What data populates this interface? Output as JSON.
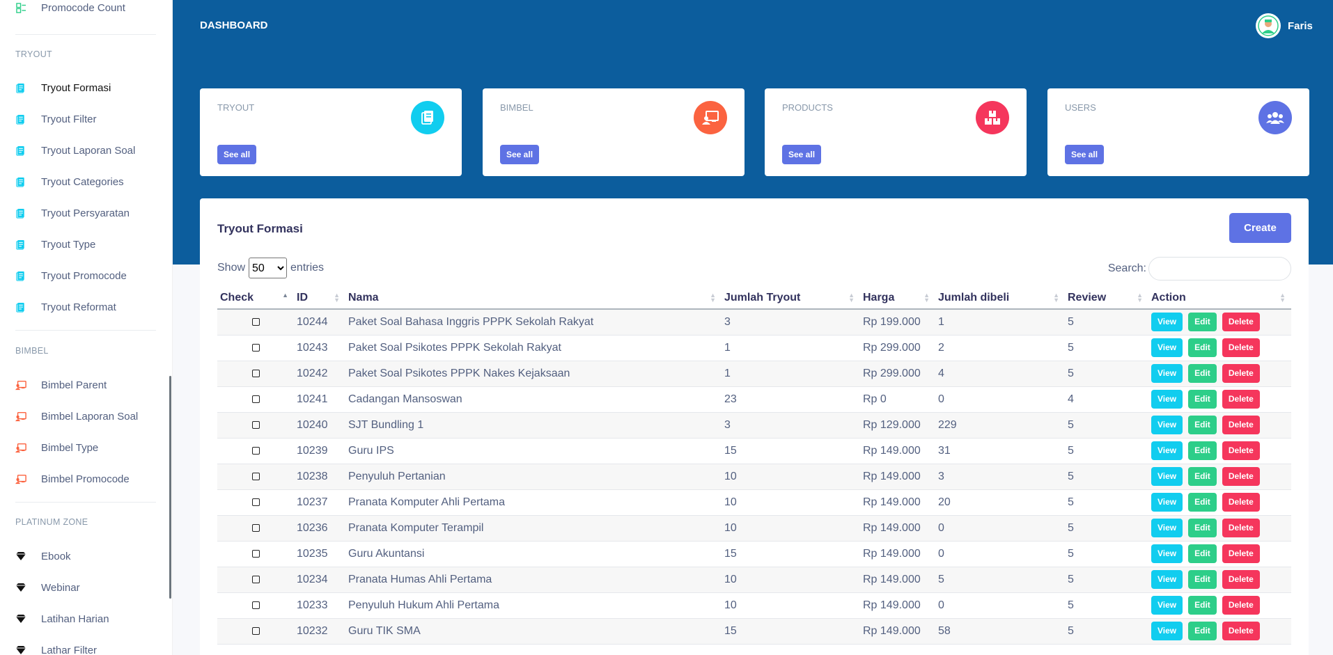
{
  "sidebar": {
    "top_item": "Promocode Count",
    "sections": [
      {
        "heading": "TRYOUT",
        "items": [
          "Tryout Formasi",
          "Tryout Filter",
          "Tryout Laporan Soal",
          "Tryout Categories",
          "Tryout Persyaratan",
          "Tryout Type",
          "Tryout Promocode",
          "Tryout Reformat"
        ]
      },
      {
        "heading": "BIMBEL",
        "items": [
          "Bimbel Parent",
          "Bimbel Laporan Soal",
          "Bimbel Type",
          "Bimbel Promocode"
        ]
      },
      {
        "heading": "PLATINUM ZONE",
        "items": [
          "Ebook",
          "Webinar",
          "Latihan Harian",
          "Lathar Filter"
        ]
      }
    ],
    "active": "Tryout Formasi"
  },
  "header": {
    "title": "DASHBOARD",
    "user": "Faris"
  },
  "cards": [
    {
      "label": "TRYOUT",
      "button": "See all",
      "color": "#11cdef",
      "icon": "document-icon"
    },
    {
      "label": "BIMBEL",
      "button": "See all",
      "color": "#fb6340",
      "icon": "presentation-icon"
    },
    {
      "label": "PRODUCTS",
      "button": "See all",
      "color": "#f5365c",
      "icon": "boxes-icon"
    },
    {
      "label": "USERS",
      "button": "See all",
      "color": "#5e72e4",
      "icon": "users-icon"
    }
  ],
  "panel": {
    "title": "Tryout Formasi",
    "create": "Create",
    "show_label": "Show",
    "entries_value": "50",
    "entries_label": "entries",
    "search_label": "Search:",
    "columns": [
      "Check",
      "ID",
      "Nama",
      "Jumlah Tryout",
      "Harga",
      "Jumlah dibeli",
      "Review",
      "Action"
    ],
    "actions": {
      "view": "View",
      "edit": "Edit",
      "delete": "Delete"
    },
    "rows": [
      {
        "id": "10244",
        "nama": "Paket Soal Bahasa Inggris PPPK Sekolah Rakyat",
        "jumlah_tryout": "3",
        "harga": "Rp 199.000",
        "jumlah_dibeli": "1",
        "review": "5"
      },
      {
        "id": "10243",
        "nama": "Paket Soal Psikotes PPPK Sekolah Rakyat",
        "jumlah_tryout": "1",
        "harga": "Rp 299.000",
        "jumlah_dibeli": "2",
        "review": "5"
      },
      {
        "id": "10242",
        "nama": "Paket Soal Psikotes PPPK Nakes Kejaksaan",
        "jumlah_tryout": "1",
        "harga": "Rp 299.000",
        "jumlah_dibeli": "4",
        "review": "5"
      },
      {
        "id": "10241",
        "nama": "Cadangan Mansoswan",
        "jumlah_tryout": "23",
        "harga": "Rp 0",
        "jumlah_dibeli": "0",
        "review": "4"
      },
      {
        "id": "10240",
        "nama": "SJT Bundling 1",
        "jumlah_tryout": "3",
        "harga": "Rp 129.000",
        "jumlah_dibeli": "229",
        "review": "5"
      },
      {
        "id": "10239",
        "nama": "Guru IPS",
        "jumlah_tryout": "15",
        "harga": "Rp 149.000",
        "jumlah_dibeli": "31",
        "review": "5"
      },
      {
        "id": "10238",
        "nama": "Penyuluh Pertanian",
        "jumlah_tryout": "10",
        "harga": "Rp 149.000",
        "jumlah_dibeli": "3",
        "review": "5"
      },
      {
        "id": "10237",
        "nama": "Pranata Komputer Ahli Pertama",
        "jumlah_tryout": "10",
        "harga": "Rp 149.000",
        "jumlah_dibeli": "20",
        "review": "5"
      },
      {
        "id": "10236",
        "nama": "Pranata Komputer Terampil",
        "jumlah_tryout": "10",
        "harga": "Rp 149.000",
        "jumlah_dibeli": "0",
        "review": "5"
      },
      {
        "id": "10235",
        "nama": "Guru Akuntansi",
        "jumlah_tryout": "15",
        "harga": "Rp 149.000",
        "jumlah_dibeli": "0",
        "review": "5"
      },
      {
        "id": "10234",
        "nama": "Pranata Humas Ahli Pertama",
        "jumlah_tryout": "10",
        "harga": "Rp 149.000",
        "jumlah_dibeli": "5",
        "review": "5"
      },
      {
        "id": "10233",
        "nama": "Penyuluh Hukum Ahli Pertama",
        "jumlah_tryout": "10",
        "harga": "Rp 149.000",
        "jumlah_dibeli": "0",
        "review": "5"
      },
      {
        "id": "10232",
        "nama": "Guru TIK SMA",
        "jumlah_tryout": "15",
        "harga": "Rp 149.000",
        "jumlah_dibeli": "58",
        "review": "5"
      }
    ]
  }
}
